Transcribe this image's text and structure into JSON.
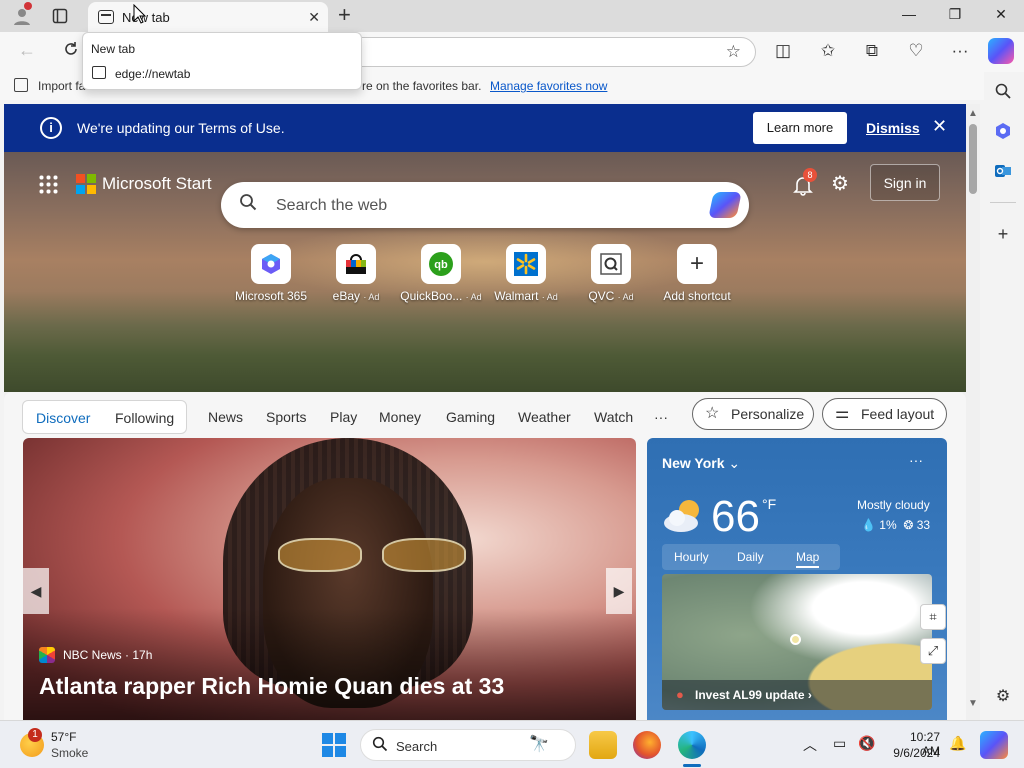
{
  "browser": {
    "tab_title": "New tab",
    "tooltip": {
      "title": "New tab",
      "url": "edge://newtab"
    },
    "favorites_bar": {
      "import_text": "Import fa",
      "hint_text": "re on the favorites bar.",
      "manage_link": "Manage favorites now"
    }
  },
  "banner": {
    "message": "We're updating our Terms of Use.",
    "learn_more": "Learn more",
    "dismiss": "Dismiss"
  },
  "header": {
    "brand": "Microsoft Start",
    "search_placeholder": "Search the web",
    "notification_count": "8",
    "sign_in": "Sign in"
  },
  "shortcuts": [
    {
      "label": "Microsoft 365",
      "ad": ""
    },
    {
      "label": "eBay",
      "ad": "· Ad"
    },
    {
      "label": "QuickBoo...",
      "ad": "· Ad"
    },
    {
      "label": "Walmart",
      "ad": "· Ad"
    },
    {
      "label": "QVC",
      "ad": "· Ad"
    },
    {
      "label": "Add shortcut",
      "ad": ""
    }
  ],
  "feed_nav": {
    "discover": "Discover",
    "following": "Following",
    "tabs": [
      "News",
      "Sports",
      "Play",
      "Money",
      "Gaming",
      "Weather",
      "Watch",
      "···"
    ],
    "personalize": "Personalize",
    "feed_layout": "Feed layout"
  },
  "news": {
    "source": "NBC News · 17h",
    "headline": "Atlanta rapper Rich Homie Quan dies at 33"
  },
  "weather": {
    "city": "New York",
    "temp": "66",
    "unit": "°F",
    "condition": "Mostly cloudy",
    "precip": "1%",
    "aqi": "33",
    "tabs": [
      "Hourly",
      "Daily",
      "Map"
    ],
    "map_caption": "Invest AL99 update"
  },
  "taskbar": {
    "alert_count": "1",
    "temp": "57°F",
    "condition": "Smoke",
    "search": "Search",
    "time": "10:27 AM",
    "date": "9/6/2024"
  },
  "colors": {
    "banner_bg": "#0a2e8e",
    "accent": "#0f6cbd",
    "weather_bg": "#3c7cc0"
  }
}
